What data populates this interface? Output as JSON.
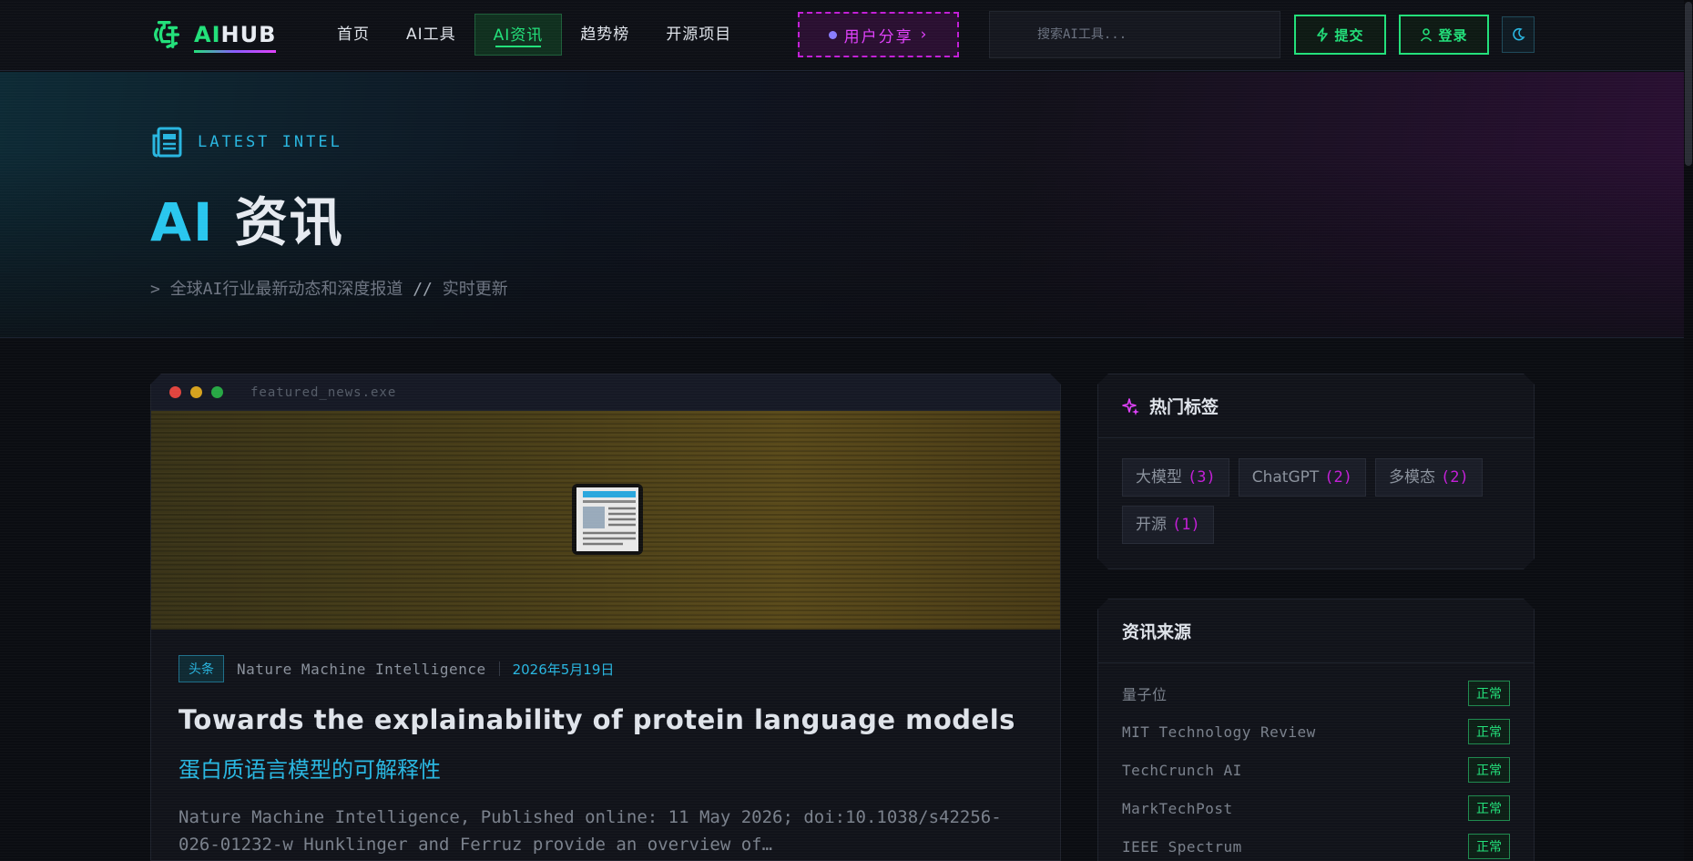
{
  "header": {
    "logo": {
      "ai": "AI",
      "hub": "HUB"
    },
    "nav": [
      {
        "label": "首页"
      },
      {
        "label": "AI工具"
      },
      {
        "label": "AI资讯"
      },
      {
        "label": "趋势榜"
      },
      {
        "label": "开源项目"
      }
    ],
    "active_nav": "AI资讯",
    "share_label": "用户分享",
    "share_arrow": "›",
    "search_placeholder": "搜索AI工具...",
    "submit_label": "提交",
    "login_label": "登录"
  },
  "hero": {
    "eyebrow": "LATEST INTEL",
    "title_ai": "AI",
    "title_rest": "资讯",
    "subtitle_prefix": ">",
    "subtitle_main": "全球AI行业最新动态和深度报道",
    "subtitle_sep": "//",
    "subtitle_tail": "实时更新"
  },
  "featured": {
    "window_title": "featured_news.exe",
    "badge": "头条",
    "source": "Nature Machine Intelligence",
    "date": "2026年5月19日",
    "title": "Towards the explainability of protein language models",
    "title_zh": "蛋白质语言模型的可解释性",
    "description": "Nature Machine Intelligence, Published online: 11 May 2026; doi:10.1038/s42256-026-01232-w Hunklinger and Ferruz provide an overview of…"
  },
  "hot_tags": {
    "title": "热门标签",
    "items": [
      {
        "label": "大模型",
        "count": "(3)"
      },
      {
        "label": "ChatGPT",
        "count": "(2)"
      },
      {
        "label": "多模态",
        "count": "(2)"
      },
      {
        "label": "开源",
        "count": "(1)"
      }
    ]
  },
  "sources": {
    "title": "资讯来源",
    "items": [
      {
        "name": "量子位",
        "status": "正常"
      },
      {
        "name": "MIT Technology Review",
        "status": "正常"
      },
      {
        "name": "TechCrunch AI",
        "status": "正常"
      },
      {
        "name": "MarkTechPost",
        "status": "正常"
      },
      {
        "name": "IEEE Spectrum",
        "status": "正常"
      }
    ]
  },
  "colors": {
    "accent_green": "#22e07a",
    "accent_cyan": "#29b6e0",
    "accent_magenta": "#e040fb",
    "background": "#0b0d12"
  },
  "icons": [
    "logo-icon",
    "newspaper-icon",
    "sparkle-icon",
    "bolt-icon",
    "user-icon",
    "moon-icon",
    "search-icon"
  ]
}
